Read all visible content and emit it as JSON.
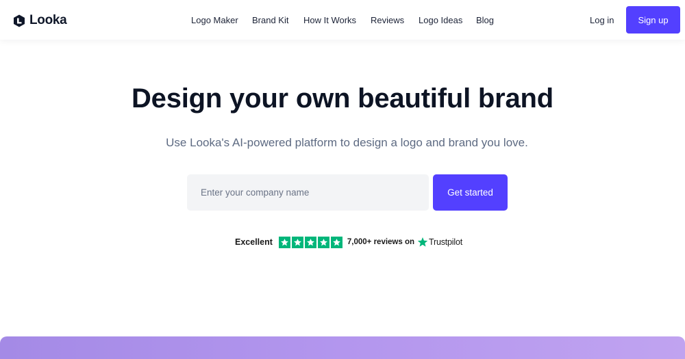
{
  "brand": {
    "name": "Looka"
  },
  "nav": {
    "items": [
      {
        "label": "Logo Maker"
      },
      {
        "label": "Brand Kit"
      },
      {
        "label": "How It Works"
      },
      {
        "label": "Reviews"
      },
      {
        "label": "Logo Ideas"
      },
      {
        "label": "Blog"
      }
    ],
    "login_label": "Log in",
    "signup_label": "Sign up"
  },
  "hero": {
    "title": "Design your own beautiful brand",
    "subtitle": "Use Looka's AI-powered platform to design a logo and brand you love.",
    "input_placeholder": "Enter your company name",
    "input_value": "",
    "cta_label": "Get started"
  },
  "trust": {
    "rating_label": "Excellent",
    "stars": 5,
    "reviews_label": "7,000+ reviews on",
    "provider": "Trustpilot"
  },
  "colors": {
    "accent": "#5340ff",
    "trustpilot_green": "#00b67a",
    "band_gradient_start": "#a48ae6",
    "band_gradient_end": "#c0a3f0"
  },
  "icons": {
    "logo": "looka-logo-icon",
    "rating_star": "star-icon",
    "provider_star": "trustpilot-star-icon"
  }
}
